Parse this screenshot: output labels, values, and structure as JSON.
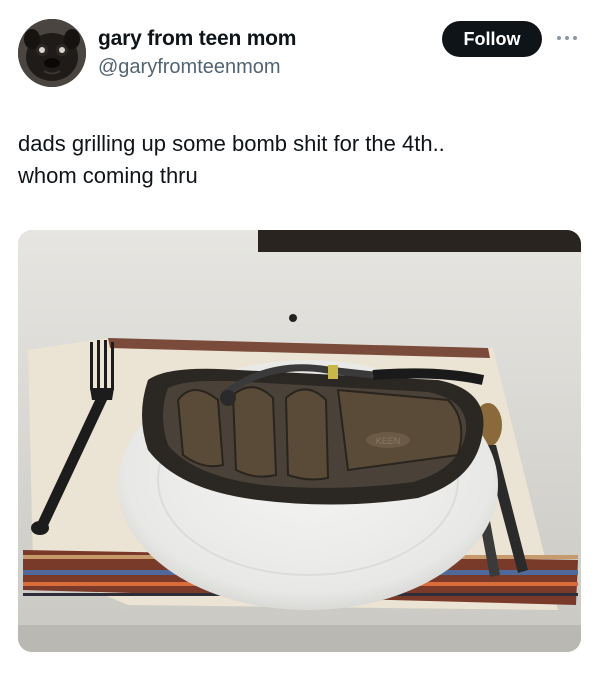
{
  "author": {
    "display_name": "gary from teen mom",
    "handle": "@garyfromteenmom",
    "avatar_icon": "pug-avatar"
  },
  "actions": {
    "follow_label": "Follow",
    "more_icon": "more-horizontal-icon"
  },
  "tweet": {
    "text_line1": "dads grilling up some bomb shit for the 4th..",
    "text_line2": "whom coming thru"
  },
  "media": {
    "image_logo_text": "KEEN"
  },
  "colors": {
    "follow_bg": "#0f1419",
    "handle": "#536471",
    "text": "#0f1419"
  }
}
